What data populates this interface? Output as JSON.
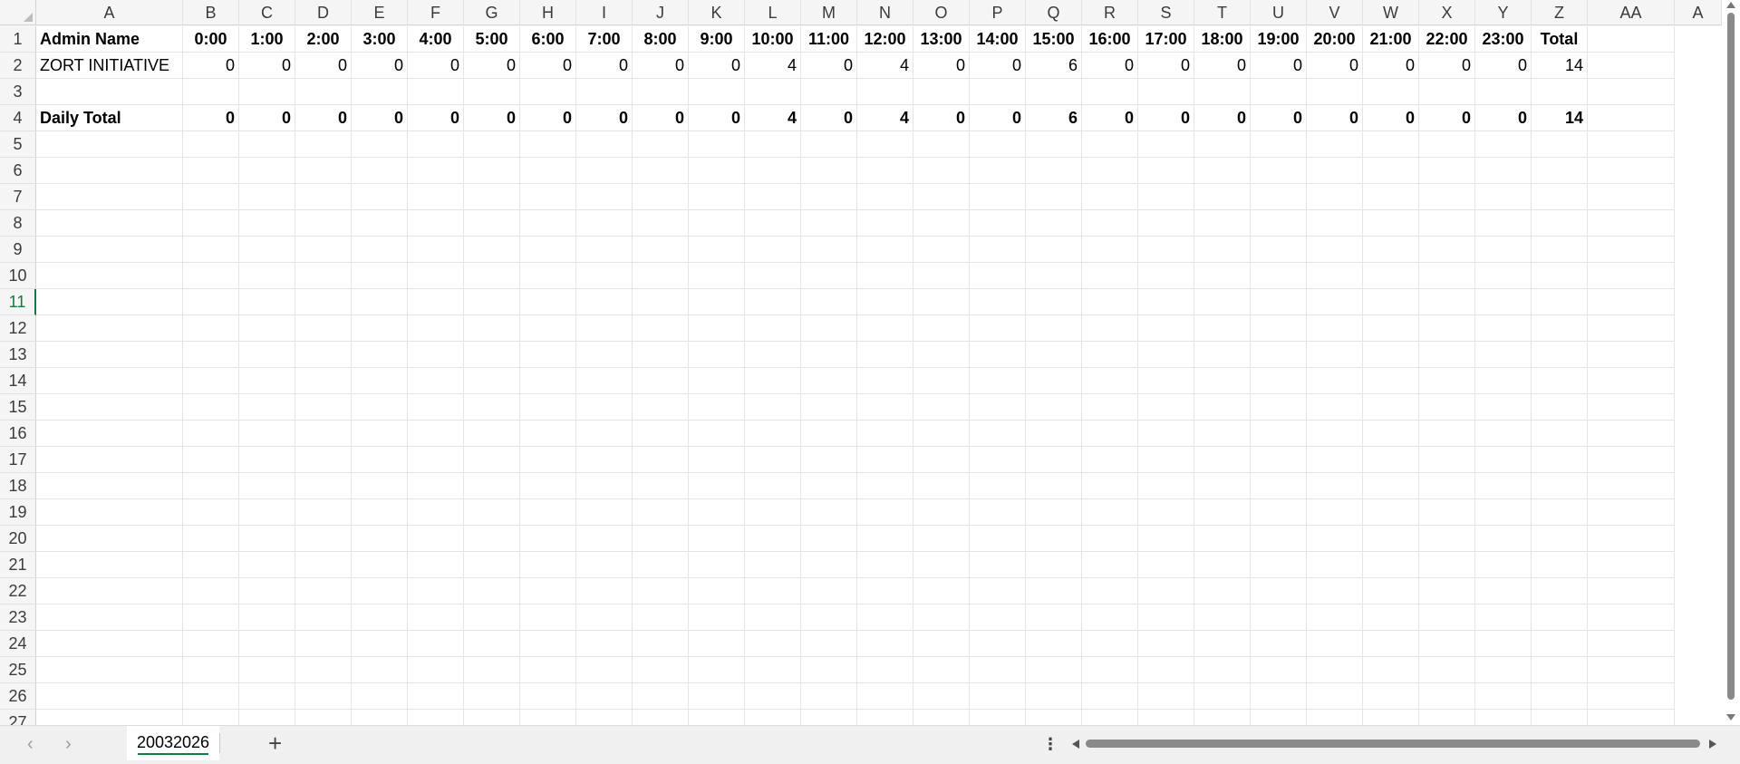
{
  "grid": {
    "columns": [
      "A",
      "B",
      "C",
      "D",
      "E",
      "F",
      "G",
      "H",
      "I",
      "J",
      "K",
      "L",
      "M",
      "N",
      "O",
      "P",
      "Q",
      "R",
      "S",
      "T",
      "U",
      "V",
      "W",
      "X",
      "Y",
      "Z",
      "AA",
      "A"
    ],
    "rows": [
      "1",
      "2",
      "3",
      "4",
      "5",
      "6",
      "7",
      "8",
      "9",
      "10",
      "11",
      "12",
      "13",
      "14",
      "15",
      "16",
      "17",
      "18",
      "19",
      "20",
      "21",
      "22",
      "23",
      "24",
      "25",
      "26",
      "27"
    ],
    "selected_row": "11",
    "header_row": {
      "name_label": "Admin Name",
      "hours": [
        "0:00",
        "1:00",
        "2:00",
        "3:00",
        "4:00",
        "5:00",
        "6:00",
        "7:00",
        "8:00",
        "9:00",
        "10:00",
        "11:00",
        "12:00",
        "13:00",
        "14:00",
        "15:00",
        "16:00",
        "17:00",
        "18:00",
        "19:00",
        "20:00",
        "21:00",
        "22:00",
        "23:00"
      ],
      "total_label": "Total"
    },
    "data_row": {
      "name": "ZORT INITIATIVE",
      "values": [
        0,
        0,
        0,
        0,
        0,
        0,
        0,
        0,
        0,
        0,
        4,
        0,
        4,
        0,
        0,
        6,
        0,
        0,
        0,
        0,
        0,
        0,
        0,
        0
      ],
      "total": 14
    },
    "total_row": {
      "label": "Daily Total",
      "values": [
        0,
        0,
        0,
        0,
        0,
        0,
        0,
        0,
        0,
        0,
        4,
        0,
        4,
        0,
        0,
        6,
        0,
        0,
        0,
        0,
        0,
        0,
        0,
        0
      ],
      "total": 14
    }
  },
  "sheet_tabs": {
    "active": "20032026",
    "add_label": "+",
    "prev_label": "‹",
    "next_label": "›",
    "more_label": "⋮"
  },
  "colors": {
    "accent": "#107c41"
  }
}
